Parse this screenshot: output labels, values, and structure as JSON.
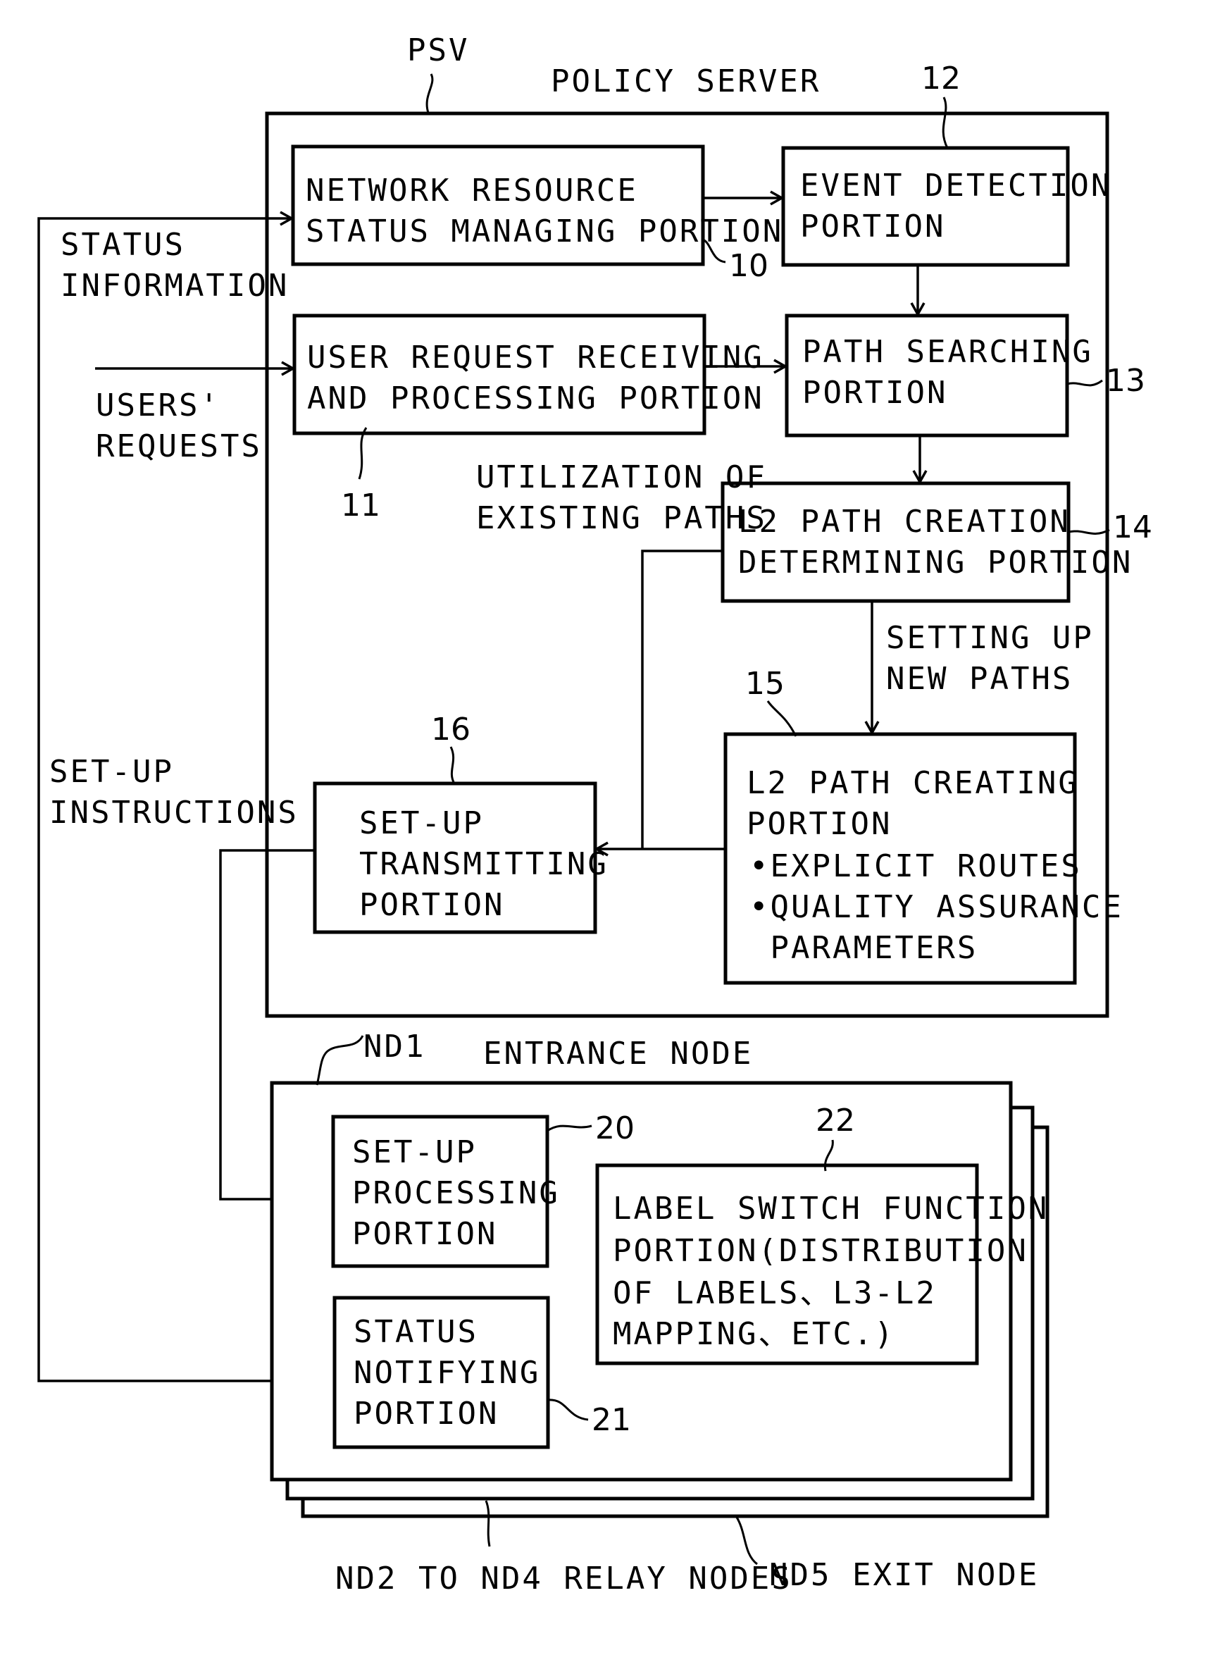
{
  "psv": {
    "ref": "PSV",
    "title": "POLICY SERVER",
    "blocks": {
      "network_resource": {
        "ref": "10",
        "lines": [
          "NETWORK RESOURCE",
          "STATUS MANAGING PORTION"
        ]
      },
      "user_request": {
        "ref": "11",
        "lines": [
          "USER REQUEST RECEIVING",
          "AND PROCESSING PORTION"
        ]
      },
      "event_detection": {
        "ref": "12",
        "lines": [
          "EVENT DETECTION",
          "PORTION"
        ]
      },
      "path_searching": {
        "ref": "13",
        "lines": [
          "PATH SEARCHING",
          "PORTION"
        ]
      },
      "l2_determining": {
        "ref": "14",
        "lines": [
          "L2 PATH CREATION",
          "DETERMINING PORTION"
        ]
      },
      "l2_creating": {
        "ref": "15",
        "lines": [
          "L2 PATH CREATING",
          "PORTION",
          "•EXPLICIT ROUTES",
          "•QUALITY ASSURANCE",
          " PARAMETERS"
        ]
      },
      "setup_transmitting": {
        "ref": "16",
        "lines": [
          "SET-UP",
          "TRANSMITTING",
          "PORTION"
        ]
      }
    },
    "edge_labels": {
      "existing": [
        "UTILIZATION OF",
        "EXISTING PATHS"
      ],
      "new": [
        "SETTING UP",
        "NEW PATHS"
      ]
    }
  },
  "external_labels": {
    "status_info": [
      "STATUS",
      "INFORMATION"
    ],
    "users_requests": [
      "USERS'",
      "REQUESTS"
    ],
    "setup_instructions": [
      "SET-UP",
      "INSTRUCTIONS"
    ]
  },
  "node": {
    "ref": "ND1",
    "title": "ENTRANCE NODE",
    "blocks": {
      "setup_processing": {
        "ref": "20",
        "lines": [
          "SET-UP",
          "PROCESSING",
          "PORTION"
        ]
      },
      "status_notifying": {
        "ref": "21",
        "lines": [
          "STATUS",
          "NOTIFYING",
          "PORTION"
        ]
      },
      "label_switch": {
        "ref": "22",
        "lines": [
          "LABEL SWITCH FUNCTION",
          "PORTION(DISTRIBUTION",
          "OF LABELS、L3-L2",
          "MAPPING、ETC.)"
        ]
      }
    },
    "relay_label": "ND2 TO ND4 RELAY NODES",
    "exit_label": "ND5 EXIT NODE"
  }
}
